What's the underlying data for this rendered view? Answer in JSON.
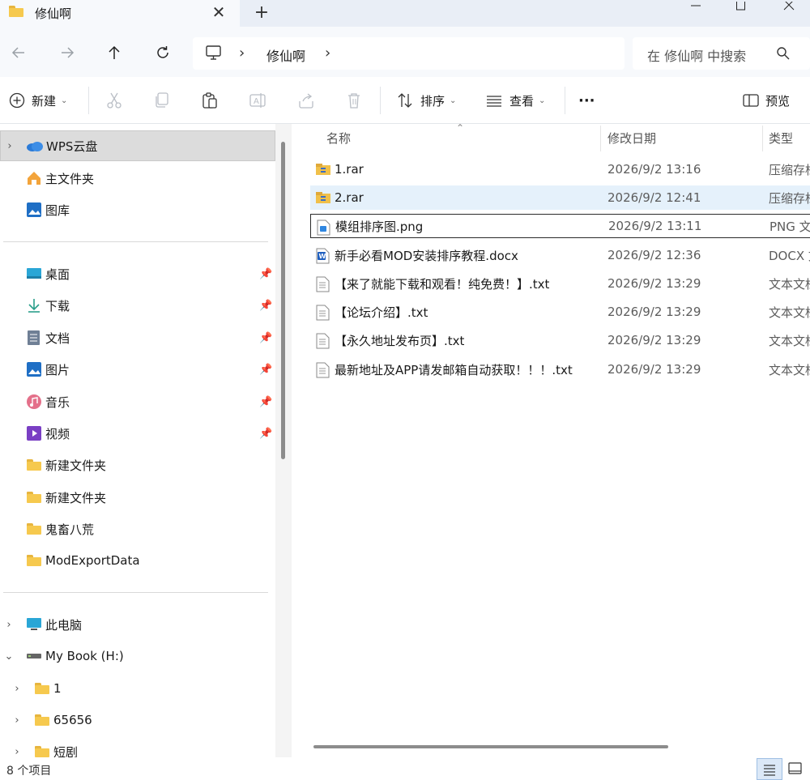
{
  "window": {
    "tab_title": "修仙啊",
    "close_glyph": "✕",
    "new_tab_glyph": "+"
  },
  "address": {
    "breadcrumb": "修仙啊",
    "sep": "›",
    "search_placeholder": "在 修仙啊 中搜索"
  },
  "toolbar": {
    "new_label": "新建",
    "sort_label": "排序",
    "view_label": "查看",
    "more_label": "···",
    "preview_label": "预览"
  },
  "nav": {
    "top_items": [
      {
        "label": "WPS云盘",
        "icon": "cloud-icon"
      },
      {
        "label": "主文件夹",
        "icon": "home-icon"
      },
      {
        "label": "图库",
        "icon": "gallery-icon"
      }
    ],
    "quick_access": [
      {
        "label": "桌面",
        "icon": "desktop-icon"
      },
      {
        "label": "下载",
        "icon": "download-icon"
      },
      {
        "label": "文档",
        "icon": "documents-icon"
      },
      {
        "label": "图片",
        "icon": "pictures-icon"
      },
      {
        "label": "音乐",
        "icon": "music-icon"
      },
      {
        "label": "视频",
        "icon": "videos-icon"
      },
      {
        "label": "新建文件夹",
        "icon": "folder-icon"
      },
      {
        "label": "新建文件夹",
        "icon": "folder-icon"
      },
      {
        "label": "鬼畜八荒",
        "icon": "folder-icon"
      },
      {
        "label": "ModExportData",
        "icon": "folder-icon"
      }
    ],
    "this_pc": "此电脑",
    "drive": "My Book (H:)",
    "drive_children": [
      "1",
      "65656",
      "短剧"
    ]
  },
  "columns": {
    "name": "名称",
    "date": "修改日期",
    "type": "类型"
  },
  "files": [
    {
      "name": "1.rar",
      "date": "2026/9/2 13:16",
      "type": "压缩存档",
      "icon": "archive-icon"
    },
    {
      "name": "2.rar",
      "date": "2026/9/2 12:41",
      "type": "压缩存档",
      "icon": "archive-icon"
    },
    {
      "name": "模组排序图.png",
      "date": "2026/9/2 13:11",
      "type": "PNG 文件",
      "icon": "image-file-icon"
    },
    {
      "name": "新手必看MOD安装排序教程.docx",
      "date": "2026/9/2 12:36",
      "type": "DOCX 文档",
      "icon": "word-doc-icon"
    },
    {
      "name": "【来了就能下载和观看！纯免费！】.txt",
      "date": "2026/9/2 13:29",
      "type": "文本文档",
      "icon": "text-file-icon"
    },
    {
      "name": "【论坛介绍】.txt",
      "date": "2026/9/2 13:29",
      "type": "文本文档",
      "icon": "text-file-icon"
    },
    {
      "name": "【永久地址发布页】.txt",
      "date": "2026/9/2 13:29",
      "type": "文本文档",
      "icon": "text-file-icon"
    },
    {
      "name": "最新地址及APP请发邮箱自动获取！！！.txt",
      "date": "2026/9/2 13:29",
      "type": "文本文档",
      "icon": "text-file-icon"
    }
  ],
  "status": {
    "item_count": "8 个项目"
  },
  "colors": {
    "accent": "#0067c0",
    "selection": "#e5f1fb",
    "nav_selected": "#dcdcdc"
  }
}
